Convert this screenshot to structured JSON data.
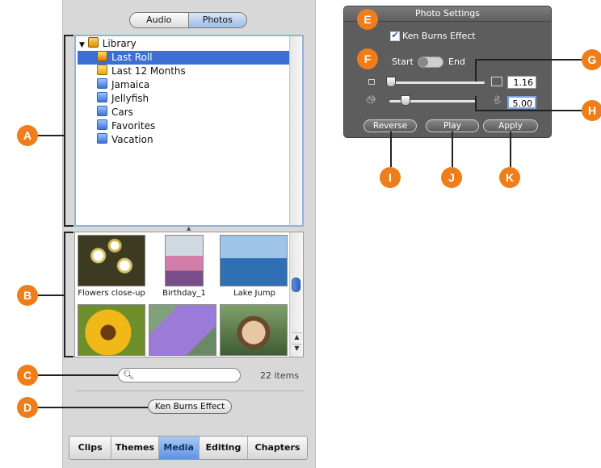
{
  "media_panel": {
    "toggle": {
      "audio": "Audio",
      "photos": "Photos"
    },
    "library": {
      "items": [
        {
          "label": "Library",
          "icon": "library-icon"
        },
        {
          "label": "Last Roll",
          "icon": "last-roll-icon",
          "selected": true
        },
        {
          "label": "Last 12 Months",
          "icon": "calendar-icon"
        },
        {
          "label": "Jamaica",
          "icon": "album-icon"
        },
        {
          "label": "Jellyfish",
          "icon": "album-icon"
        },
        {
          "label": "Cars",
          "icon": "album-icon"
        },
        {
          "label": "Favorites",
          "icon": "album-icon"
        },
        {
          "label": "Vacation",
          "icon": "album-icon"
        }
      ]
    },
    "photos": [
      {
        "caption": "Flowers close-up"
      },
      {
        "caption": "Birthday_1"
      },
      {
        "caption": "Lake Jump"
      },
      {
        "caption": ""
      },
      {
        "caption": ""
      },
      {
        "caption": ""
      }
    ],
    "search": {
      "placeholder": ""
    },
    "item_count": "22 items",
    "ken_burns_button": "Ken Burns Effect",
    "tabs": [
      "Clips",
      "Themes",
      "Media",
      "Editing",
      "Chapters"
    ],
    "active_tab": "Media"
  },
  "photo_settings": {
    "title": "Photo Settings",
    "ken_burns_checkbox": {
      "label": "Ken Burns Effect",
      "checked": true
    },
    "start_label": "Start",
    "end_label": "End",
    "zoom_value": "1.16",
    "duration_value": "5.00",
    "zoom_slider_level": 0.0,
    "duration_slider_level": 0.18,
    "buttons": {
      "reverse": "Reverse",
      "play": "Play",
      "apply": "Apply"
    }
  },
  "callouts": [
    "A",
    "B",
    "C",
    "D",
    "E",
    "F",
    "G",
    "H",
    "I",
    "J",
    "K"
  ],
  "colors": {
    "callout": "#ef7d1a",
    "selection": "#3b6fd4",
    "active_tab": "#5e93e0",
    "hud": "#5d5d5d"
  }
}
